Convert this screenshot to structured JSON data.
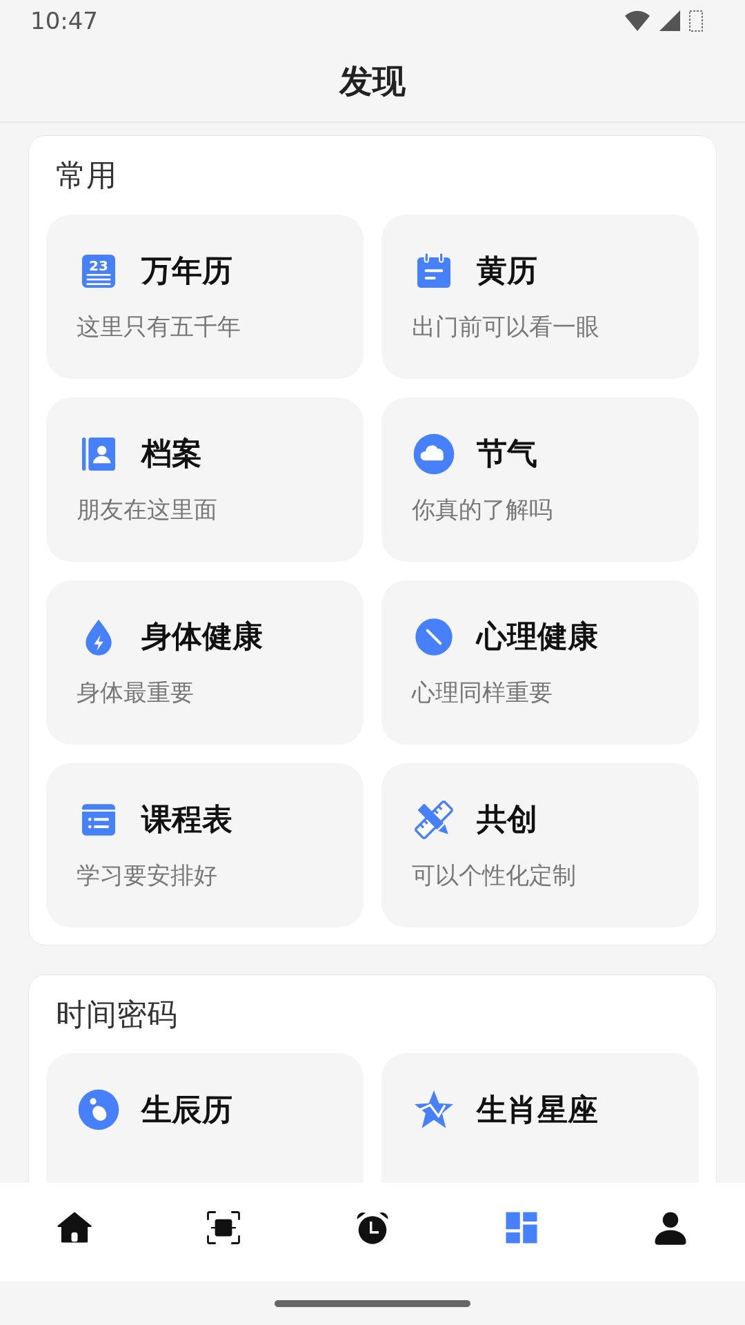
{
  "status_bar": {
    "time": "10:47"
  },
  "header": {
    "title": "发现"
  },
  "sections": [
    {
      "title": "常用",
      "tiles": [
        {
          "title": "万年历",
          "subtitle": "这里只有五千年",
          "icon_text": "23"
        },
        {
          "title": "黄历",
          "subtitle": "出门前可以看一眼"
        },
        {
          "title": "档案",
          "subtitle": "朋友在这里面"
        },
        {
          "title": "节气",
          "subtitle": "你真的了解吗"
        },
        {
          "title": "身体健康",
          "subtitle": "身体最重要"
        },
        {
          "title": "心理健康",
          "subtitle": "心理同样重要"
        },
        {
          "title": "课程表",
          "subtitle": "学习要安排好"
        },
        {
          "title": "共创",
          "subtitle": "可以个性化定制"
        }
      ]
    },
    {
      "title": "时间密码",
      "tiles": [
        {
          "title": "生辰历"
        },
        {
          "title": "生肖星座"
        }
      ]
    }
  ],
  "bottom_nav": [
    {
      "kind": "home",
      "selected": false
    },
    {
      "kind": "scan",
      "selected": false
    },
    {
      "kind": "alarm",
      "selected": false
    },
    {
      "kind": "discover",
      "selected": true
    },
    {
      "kind": "profile",
      "selected": false
    }
  ]
}
